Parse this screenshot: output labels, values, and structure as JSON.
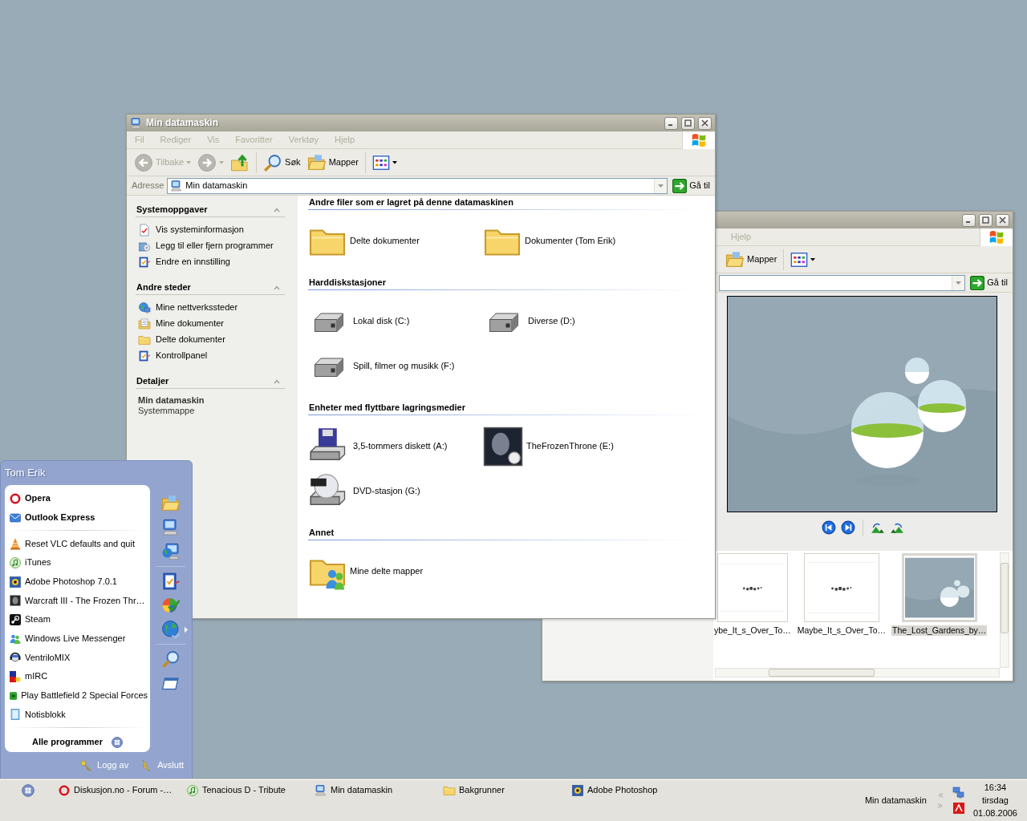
{
  "explorer": {
    "title": "Min datamaskin",
    "active": false,
    "menu": [
      "Fil",
      "Rediger",
      "Vis",
      "Favoritter",
      "Verktøy",
      "Hjelp"
    ],
    "toolbar": {
      "back": {
        "label": "Tilbake",
        "disabled": true
      },
      "forward": {
        "disabled": true
      },
      "search": "Søk",
      "folders": "Mapper"
    },
    "address": {
      "label": "Adresse",
      "value": "Min datamaskin",
      "go": "Gå til"
    },
    "task_panes": [
      {
        "title": "Systemoppgaver",
        "expanded": true,
        "items": [
          "Vis systeminformasjon",
          "Legg til eller fjern programmer",
          "Endre en innstilling"
        ]
      },
      {
        "title": "Andre steder",
        "expanded": true,
        "items": [
          "Mine nettverkssteder",
          "Mine dokumenter",
          "Delte dokumenter",
          "Kontrollpanel"
        ]
      }
    ],
    "details": {
      "title": "Detaljer",
      "expanded": true,
      "name": "Min datamaskin",
      "description": "Systemmappe"
    },
    "groups": [
      {
        "title": "Andre filer som er lagret på denne datamaskinen",
        "items": [
          {
            "kind": "folder",
            "label": "Delte dokumenter"
          },
          {
            "kind": "folder",
            "label": "Dokumenter (Tom Erik)"
          }
        ]
      },
      {
        "title": "Harddiskstasjoner",
        "items": [
          {
            "kind": "drive",
            "label": "Lokal disk (C:)"
          },
          {
            "kind": "drive",
            "label": "Diverse (D:)"
          },
          {
            "kind": "drive",
            "label": "Spill, filmer og musikk (F:)"
          }
        ]
      },
      {
        "title": "Enheter med flyttbare lagringsmedier",
        "items": [
          {
            "kind": "floppy",
            "label": "3,5-tommers diskett (A:)"
          },
          {
            "kind": "cd",
            "label": "TheFrozenThrone (E:)"
          },
          {
            "kind": "dvd",
            "label": "DVD-stasjon (G:)"
          }
        ]
      },
      {
        "title": "Annet",
        "items": [
          {
            "kind": "shared",
            "label": "Mine delte mapper"
          }
        ]
      }
    ]
  },
  "viewer": {
    "active": false,
    "menu": [
      "Hjelp"
    ],
    "folders": "Mapper",
    "go": "Gå til",
    "thumbnails": [
      {
        "kind": "logo",
        "caption": "ybe_It_s_Over_To…",
        "selected": false
      },
      {
        "kind": "logo",
        "caption": "Maybe_It_s_Over_To…",
        "selected": false
      },
      {
        "kind": "globes",
        "caption": "The_Lost_Gardens_by…",
        "selected": true
      }
    ]
  },
  "start_menu": {
    "user": "Tom Erik",
    "pinned": [
      "Opera",
      "Outlook Express"
    ],
    "recent": [
      "Reset VLC defaults and quit",
      "iTunes",
      "Adobe Photoshop 7.0.1",
      "Warcraft III - The Frozen Thr…",
      "Steam",
      "Windows Live Messenger",
      "VentriloMIX",
      "mIRC",
      "Play Battlefield 2 Special Forces",
      "Notisblokk"
    ],
    "all_programs": "Alle programmer",
    "log_off": "Logg av",
    "shut_down": "Avslutt"
  },
  "taskbar": {
    "tasks": [
      "Diskusjon.no - Forum -…",
      "Tenacious D - Tribute",
      "Min datamaskin",
      "Bakgrunner",
      "Adobe Photoshop"
    ],
    "toolbar": "Min datamaskin",
    "clock": {
      "time": "16:34",
      "day": "tirsdag",
      "date": "01.08.2006"
    }
  }
}
